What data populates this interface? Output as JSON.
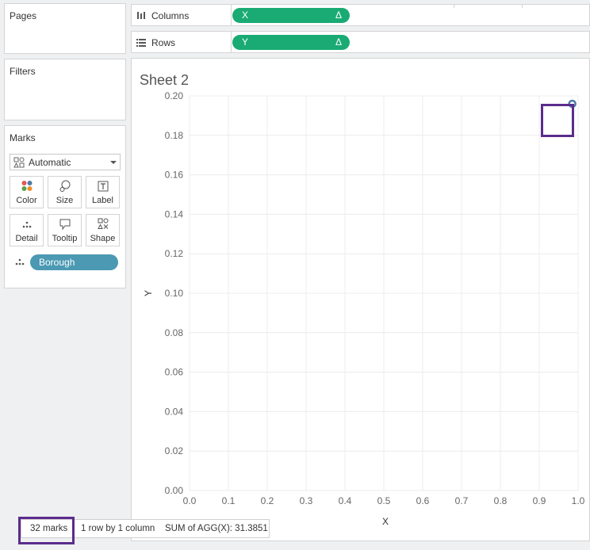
{
  "pages": {
    "title": "Pages"
  },
  "filters": {
    "title": "Filters"
  },
  "marks": {
    "title": "Marks",
    "mark_type": "Automatic",
    "cards": [
      "Color",
      "Size",
      "Label",
      "Detail",
      "Tooltip",
      "Shape"
    ],
    "detail_field": "Borough"
  },
  "shelves": {
    "columns": {
      "label": "Columns",
      "pill": "X",
      "pill_suffix": "Δ"
    },
    "rows": {
      "label": "Rows",
      "pill": "Y",
      "pill_suffix": "Δ"
    }
  },
  "sheet": {
    "title": "Sheet 2"
  },
  "colors": {
    "measure_pill": "#1aab74",
    "dimension_pill": "#4b99b3",
    "highlight": "#5b2c8c",
    "mark": "#4e79a7"
  },
  "chart_data": {
    "type": "scatter",
    "title": "Sheet 2",
    "xlabel": "X",
    "ylabel": "Y",
    "xlim": [
      0.0,
      1.0
    ],
    "ylim": [
      0.0,
      0.2
    ],
    "x_ticks": [
      "0.0",
      "0.1",
      "0.2",
      "0.3",
      "0.4",
      "0.5",
      "0.6",
      "0.7",
      "0.8",
      "0.9",
      "1.0"
    ],
    "y_ticks": [
      "0.00",
      "0.02",
      "0.04",
      "0.06",
      "0.08",
      "0.10",
      "0.12",
      "0.14",
      "0.16",
      "0.18",
      "0.20"
    ],
    "grid": true,
    "points": [
      {
        "x": 0.985,
        "y": 0.196
      }
    ]
  },
  "status": {
    "marks": "32 marks",
    "dims": "1 row by 1 column",
    "sum": "SUM of AGG(X): 31.3851"
  }
}
